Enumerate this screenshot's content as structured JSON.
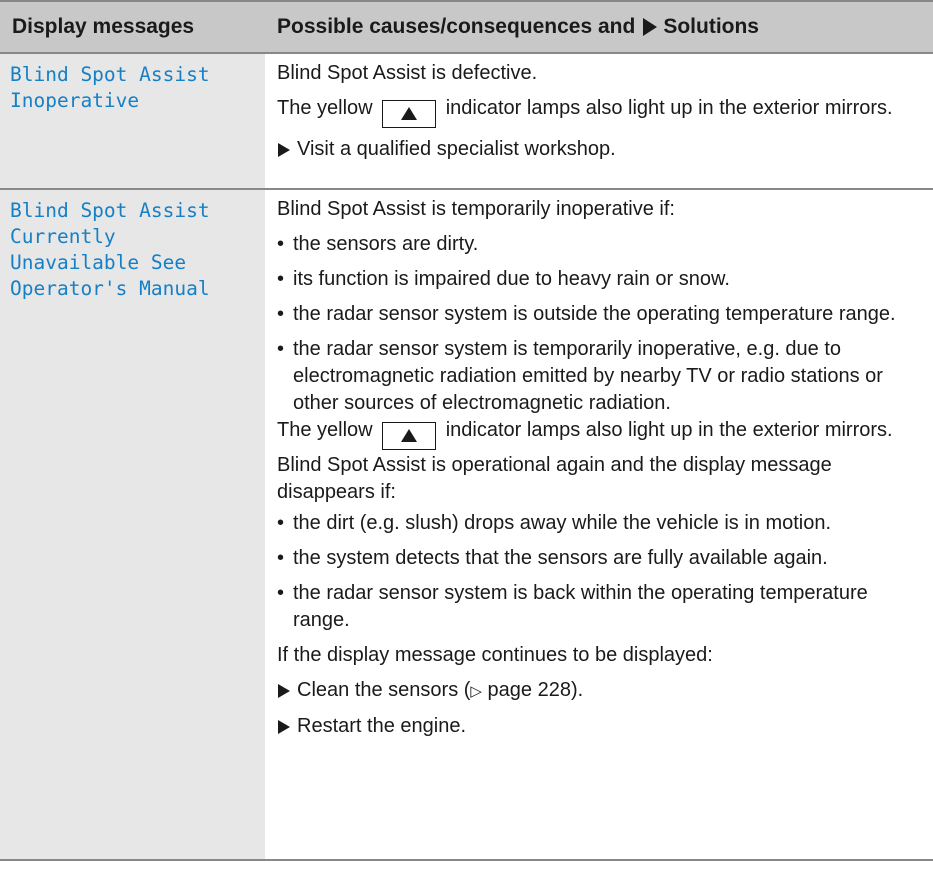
{
  "header": {
    "col1": "Display messages",
    "col2_pre": "Possible causes/consequences and",
    "col2_post": "Solutions"
  },
  "rows": [
    {
      "message": "Blind Spot Assist\nInoperative",
      "p1": "Blind Spot Assist is defective.",
      "lamp_pre": "The yellow",
      "lamp_post": "indicator lamps also light up in the exterior mirrors.",
      "step1": "Visit a qualified specialist workshop."
    },
    {
      "message": "Blind Spot Assist\nCurrently\nUnavailable See\nOperator's Manual",
      "intro": "Blind Spot Assist is temporarily inoperative if:",
      "bullets_a": [
        "the sensors are dirty.",
        "its function is impaired due to heavy rain or snow.",
        "the radar sensor system is outside the operating temperature range.",
        "the radar sensor system is temporarily inoperative, e.g. due to electromagnetic radiation emitted by nearby TV or radio stations or other sources of electromagnetic radiation."
      ],
      "lamp_pre": "The yellow",
      "lamp_post": "indicator lamps also light up in the exterior mirrors.",
      "again": "Blind Spot Assist is operational again and the display message disappears if:",
      "bullets_b": [
        "the dirt (e.g. slush) drops away while the vehicle is in motion.",
        "the system detects that the sensors are fully available again.",
        "the radar sensor system is back within the operating temperature range."
      ],
      "continues": "If the display message continues to be displayed:",
      "step1_pre": "Clean the sensors (",
      "step1_ref": "▷",
      "step1_post": " page 228).",
      "step2": "Restart the engine."
    }
  ],
  "colors": {
    "header_bg": "#c8c8c8",
    "message_col_bg": "#e7e7e7",
    "message_text": "#1680c6",
    "rule": "#888888"
  }
}
